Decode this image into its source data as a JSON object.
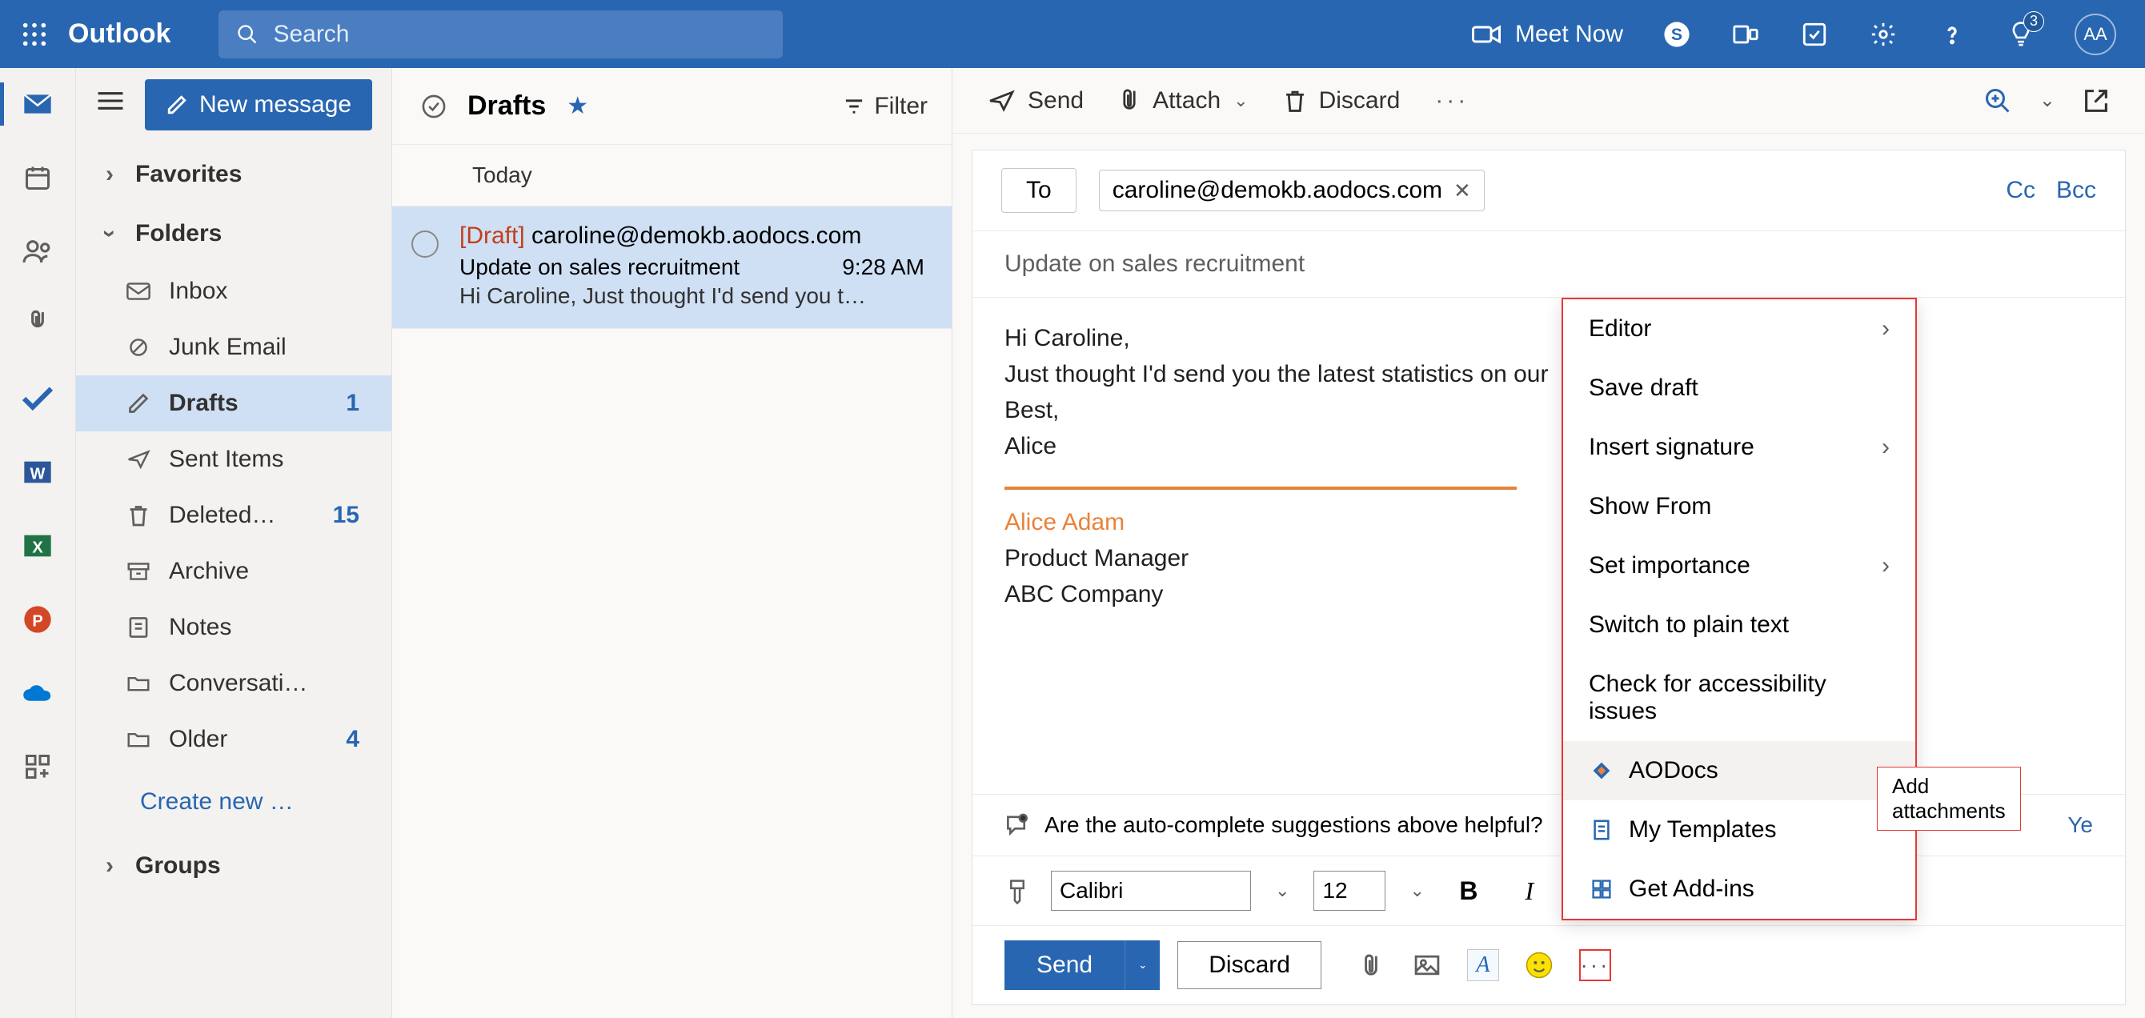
{
  "header": {
    "app_name": "Outlook",
    "search_placeholder": "Search",
    "meet_now": "Meet Now",
    "notif_count": "3",
    "avatar_initials": "AA"
  },
  "sidebar": {
    "new_message": "New message",
    "favorites": "Favorites",
    "folders_label": "Folders",
    "folders": [
      {
        "label": "Inbox",
        "count": ""
      },
      {
        "label": "Junk Email",
        "count": ""
      },
      {
        "label": "Drafts",
        "count": "1"
      },
      {
        "label": "Sent Items",
        "count": ""
      },
      {
        "label": "Deleted…",
        "count": "15"
      },
      {
        "label": "Archive",
        "count": ""
      },
      {
        "label": "Notes",
        "count": ""
      },
      {
        "label": "Conversati…",
        "count": ""
      },
      {
        "label": "Older",
        "count": "4"
      }
    ],
    "create_new": "Create new …",
    "groups": "Groups"
  },
  "msglist": {
    "title": "Drafts",
    "filter": "Filter",
    "group": "Today",
    "item": {
      "draft_tag": "[Draft]",
      "from": "caroline@demokb.aodocs.com",
      "subject": "Update on sales recruitment",
      "time": "9:28 AM",
      "preview": "Hi Caroline, Just thought I'd send you t…"
    }
  },
  "compose_toolbar": {
    "send": "Send",
    "attach": "Attach",
    "discard": "Discard"
  },
  "compose": {
    "to_label": "To",
    "recipient": "caroline@demokb.aodocs.com",
    "cc": "Cc",
    "bcc": "Bcc",
    "subject": "Update on sales recruitment",
    "body_line1": "Hi Caroline,",
    "body_line2": "Just thought I'd send you the latest statistics on our",
    "body_line3": "Best,",
    "body_line4": "Alice",
    "sig_name": "Alice Adam",
    "sig_title": "Product Manager",
    "sig_company": "ABC Company",
    "helpful_text": "Are the auto-complete suggestions above helpful?",
    "helpful_yes": "Ye",
    "font_name": "Calibri",
    "font_size": "12",
    "send_button": "Send",
    "discard_button": "Discard"
  },
  "context_menu": {
    "items": [
      {
        "label": "Editor",
        "arrow": true
      },
      {
        "label": "Save draft"
      },
      {
        "label": "Insert signature",
        "arrow": true
      },
      {
        "label": "Show From"
      },
      {
        "label": "Set importance",
        "arrow": true
      },
      {
        "label": "Switch to plain text"
      },
      {
        "label": "Check for accessibility issues"
      },
      {
        "label": "AODocs",
        "icon": "aodocs",
        "hover": true
      },
      {
        "label": "My Templates",
        "icon": "templates"
      },
      {
        "label": "Get Add-ins",
        "icon": "addins"
      }
    ],
    "tooltip": "Add attachments"
  }
}
